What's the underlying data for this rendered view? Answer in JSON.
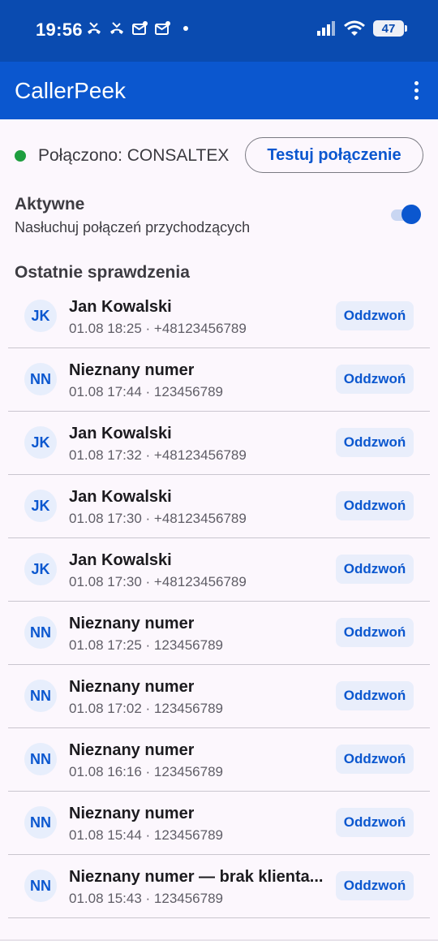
{
  "status_bar": {
    "time": "19:56",
    "battery": "47",
    "notification_icons": [
      "missed-call-icon",
      "missed-call-icon",
      "mail-icon",
      "mail-icon"
    ],
    "colors": {
      "background": "#0a4bb0"
    }
  },
  "app_bar": {
    "title": "CallerPeek",
    "menu_icon": "more-vert-icon",
    "colors": {
      "background": "#0b57cf"
    }
  },
  "connection": {
    "status_text": "Połączono: CONSALTEX",
    "status_color": "#1e9e3f",
    "test_button_label": "Testuj połączenie"
  },
  "active_setting": {
    "title": "Aktywne",
    "subtitle": "Nasłuchuj połączeń przychodzących",
    "enabled": true
  },
  "recent": {
    "title": "Ostatnie sprawdzenia",
    "call_back_label": "Oddzwoń",
    "items": [
      {
        "initials": "JK",
        "name": "Jan Kowalski",
        "meta": "01.08 18:25 · +48123456789"
      },
      {
        "initials": "NN",
        "name": "Nieznany numer",
        "meta": "01.08 17:44 · 123456789"
      },
      {
        "initials": "JK",
        "name": "Jan Kowalski",
        "meta": "01.08 17:32 · +48123456789"
      },
      {
        "initials": "JK",
        "name": "Jan Kowalski",
        "meta": "01.08 17:30 · +48123456789"
      },
      {
        "initials": "JK",
        "name": "Jan Kowalski",
        "meta": "01.08 17:30 · +48123456789"
      },
      {
        "initials": "NN",
        "name": "Nieznany numer",
        "meta": "01.08 17:25 · 123456789"
      },
      {
        "initials": "NN",
        "name": "Nieznany numer",
        "meta": "01.08 17:02 · 123456789"
      },
      {
        "initials": "NN",
        "name": "Nieznany numer",
        "meta": "01.08 16:16 · 123456789"
      },
      {
        "initials": "NN",
        "name": "Nieznany numer",
        "meta": "01.08 15:44 · 123456789"
      },
      {
        "initials": "NN",
        "name": "Nieznany numer — brak klienta...",
        "meta": "01.08 15:43 · 123456789"
      }
    ]
  }
}
